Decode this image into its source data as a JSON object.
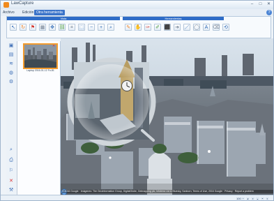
{
  "window": {
    "title": "LawCapture",
    "menu": [
      "Archivo",
      "Edición",
      "Otra herramienta"
    ],
    "active_menu_index": 2
  },
  "ribbon": {
    "groups": [
      "Vista",
      "Herramientas"
    ],
    "tools_group_1": [
      "arrow-icon",
      "rotate-icon",
      "layers-icon",
      "grid-icon",
      "move-icon",
      "link-icon",
      "crop-icon",
      "select-icon",
      "zoom-out-icon",
      "zoom-in-icon",
      "zoom-fit-icon"
    ],
    "tools_group_2": [
      "note-icon",
      "hand-icon",
      "pen-icon",
      "marker-icon",
      "paint-icon",
      "arrow-icon",
      "line-icon",
      "shape-icon",
      "text-icon",
      "eraser-icon",
      "rotate-icon"
    ]
  },
  "sidebar": {
    "icons": [
      "page-icon",
      "image-icon",
      "layers-icon",
      "globe-icon",
      "tool-icon",
      "search-icon",
      "print-icon",
      "bookmark-icon",
      "close-icon",
      "settings-icon"
    ]
  },
  "thumbnail": {
    "caption": "Laptop 2016-01-12 Fo-81"
  },
  "scene": {
    "attribution": "© 2016 Google · Imágenes: The GeoInformation Group, DigitalGlobe, Getmapping plc, Infoterra Ltd & Bluesky, Sanborn, Terms of Use, 2016 Google · Privacy · Report a problem"
  },
  "status": {
    "zoom": "100",
    "icons": [
      "status-icon-a",
      "status-icon-b",
      "status-icon-c",
      "status-icon-d",
      "status-icon-e",
      "status-icon-f"
    ]
  }
}
